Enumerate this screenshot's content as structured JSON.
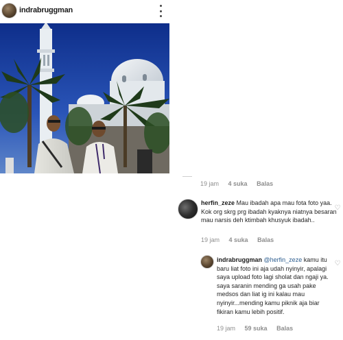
{
  "post": {
    "username": "indrabruggman",
    "avatar_icon": "profile-avatar-icon",
    "more_icon": "more-options-icon"
  },
  "top_comment_meta": {
    "time": "19 jam",
    "likes": "4 suka",
    "reply": "Balas"
  },
  "comments": [
    {
      "username": "herfin_zeze",
      "text": "Mau ibadah apa mau fota foto yaa. Kok org skrg prg ibadah kyaknya niatnya besaran mau narsis deh ktimbah khusyuk ibadah..",
      "time": "19 jam",
      "likes": "4 suka",
      "reply": "Balas"
    },
    {
      "username": "indrabruggman",
      "mention": "@herfin_zeze",
      "text": "kamu itu baru liat foto ini aja udah nyinyir, apalagi saya upload foto lagi sholat dan ngaji ya.  saya saranin mending ga usah pake medsos dan liat ig ini kalau mau nyinyir...mending kamu piknik aja biar fikiran kamu lebih positif.",
      "time": "19 jam",
      "likes": "59 suka",
      "reply": "Balas"
    }
  ],
  "icons": {
    "heart": "heart-outline-icon"
  },
  "colors": {
    "text": "#262626",
    "meta": "#8e8e8e",
    "mention": "#2c5d8f"
  }
}
